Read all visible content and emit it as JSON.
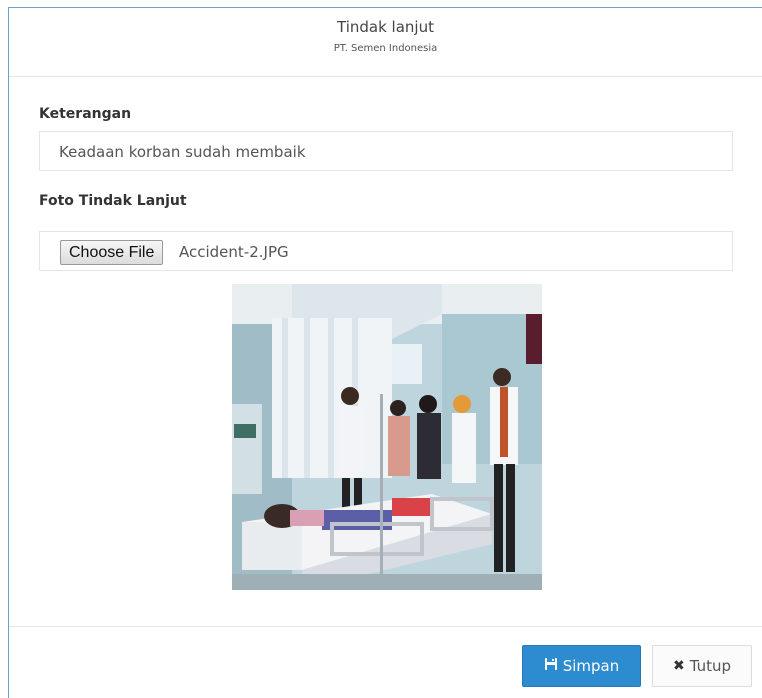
{
  "header": {
    "title": "Tindak lanjut",
    "subtitle": "PT. Semen Indonesia"
  },
  "form": {
    "keterangan_label": "Keterangan",
    "keterangan_value": "Keadaan korban sudah membaik",
    "foto_label": "Foto Tindak Lanjut",
    "choose_file_label": "Choose File",
    "file_name": "Accident-2.JPG",
    "photo_icon": "hospital-photo"
  },
  "footer": {
    "save_label": "Simpan",
    "save_icon": "floppy-disk-icon",
    "close_label": "Tutup",
    "close_icon": "x-icon"
  },
  "colors": {
    "primary": "#2d8bd0",
    "frame": "#6f9fc8"
  }
}
